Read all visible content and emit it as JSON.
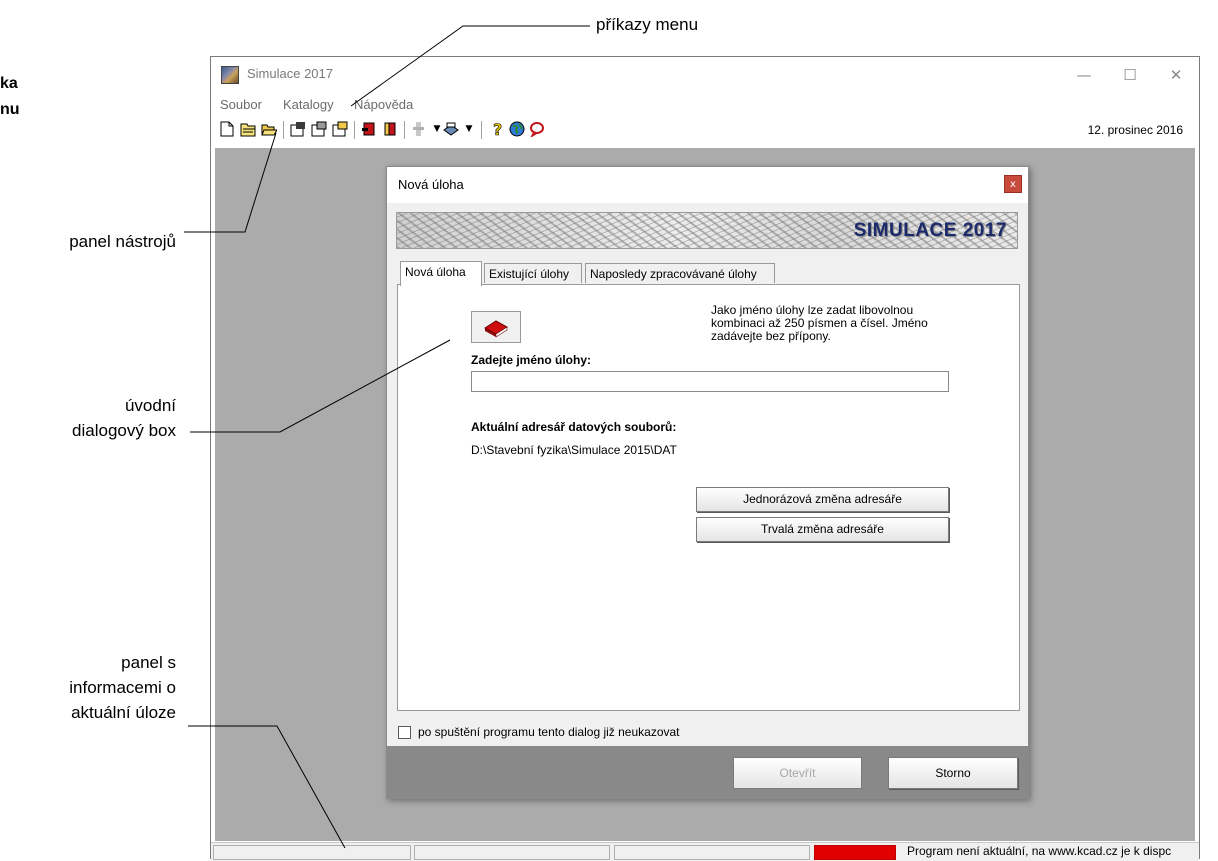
{
  "annotations": {
    "menu_commands": "příkazy menu",
    "menu_bar_fragment": [
      "ka",
      "nu"
    ],
    "toolbar": "panel nástrojů",
    "dialog": [
      "úvodní",
      "dialogový box"
    ],
    "info_panel": [
      "panel s",
      "informacemi o",
      "aktuální úloze"
    ]
  },
  "window": {
    "title": "Simulace 2017",
    "controls": {
      "minimize": "—",
      "maximize": "☐",
      "close": "✕"
    },
    "menu": [
      "Soubor",
      "Katalogy",
      "Nápověda"
    ],
    "date": "12. prosinec 2016",
    "status": {
      "message": "Program není aktuální, na www.kcad.cz je k dispc",
      "alert_color": "#e00000"
    }
  },
  "toolbar_icons": [
    "new-icon",
    "open-icon",
    "open-folder-icon",
    "properties-icon",
    "properties2-icon",
    "properties3-icon",
    "red-book-icon",
    "red-yellow-book-icon",
    "disabled-tool-icon",
    "chevron-down-icon",
    "export-icon",
    "chevron-down-icon",
    "help-icon",
    "globe-icon",
    "chat-icon"
  ],
  "dialog": {
    "title": "Nová úloha",
    "close": "x",
    "banner": "SIMULACE 2017",
    "tabs": [
      "Nová úloha",
      "Existující úlohy",
      "Naposledy zpracovávané úlohy"
    ],
    "note": "Jako jméno úlohy lze zadat libovolnou kombinaci až 250 písmen a čísel. Jméno zadávejte bez přípony.",
    "name_label": "Zadejte jméno úlohy:",
    "name_value": "",
    "dir_label": "Aktuální adresář datových souborů:",
    "dir_path": "D:\\Stavební fyzika\\Simulace 2015\\DAT",
    "btn_once": "Jednorázová změna adresáře",
    "btn_permanent": "Trvalá změna adresáře",
    "checkbox_label": "po spuštění programu tento dialog již neukazovat",
    "btn_open": "Otevřít",
    "btn_cancel": "Storno"
  }
}
